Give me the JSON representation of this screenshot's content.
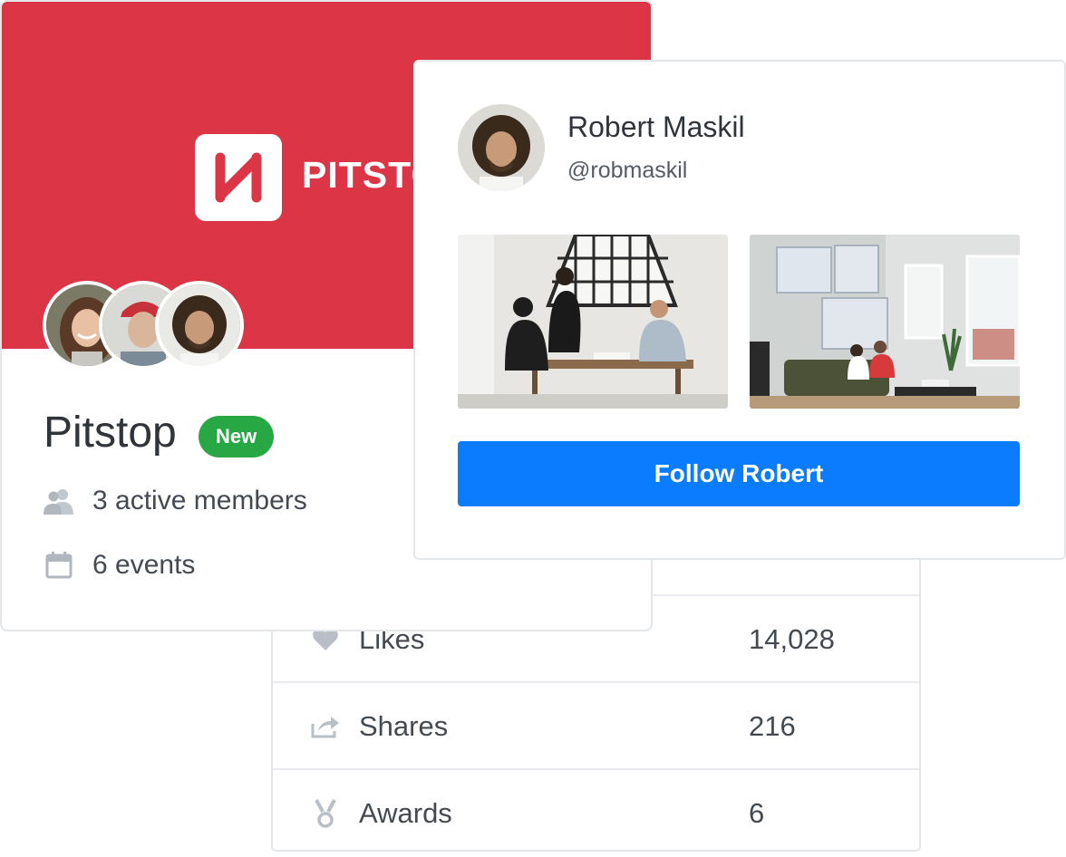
{
  "stats": {
    "rows": [
      {
        "label": "Likes",
        "value": "14,028",
        "icon": "heart-icon"
      },
      {
        "label": "Shares",
        "value": "216",
        "icon": "share-icon"
      },
      {
        "label": "Awards",
        "value": "6",
        "icon": "medal-icon"
      }
    ]
  },
  "group": {
    "brand_name": "PITSTOP",
    "title": "Pitstop",
    "badge": "New",
    "members_text": "3 active members",
    "events_text": "6 events",
    "banner_color": "#dc3545",
    "badge_color": "#28a745"
  },
  "profile": {
    "name": "Robert Maskil",
    "handle": "@robmaskil",
    "follow_label": "Follow Robert",
    "button_color": "#0a7cfd"
  }
}
